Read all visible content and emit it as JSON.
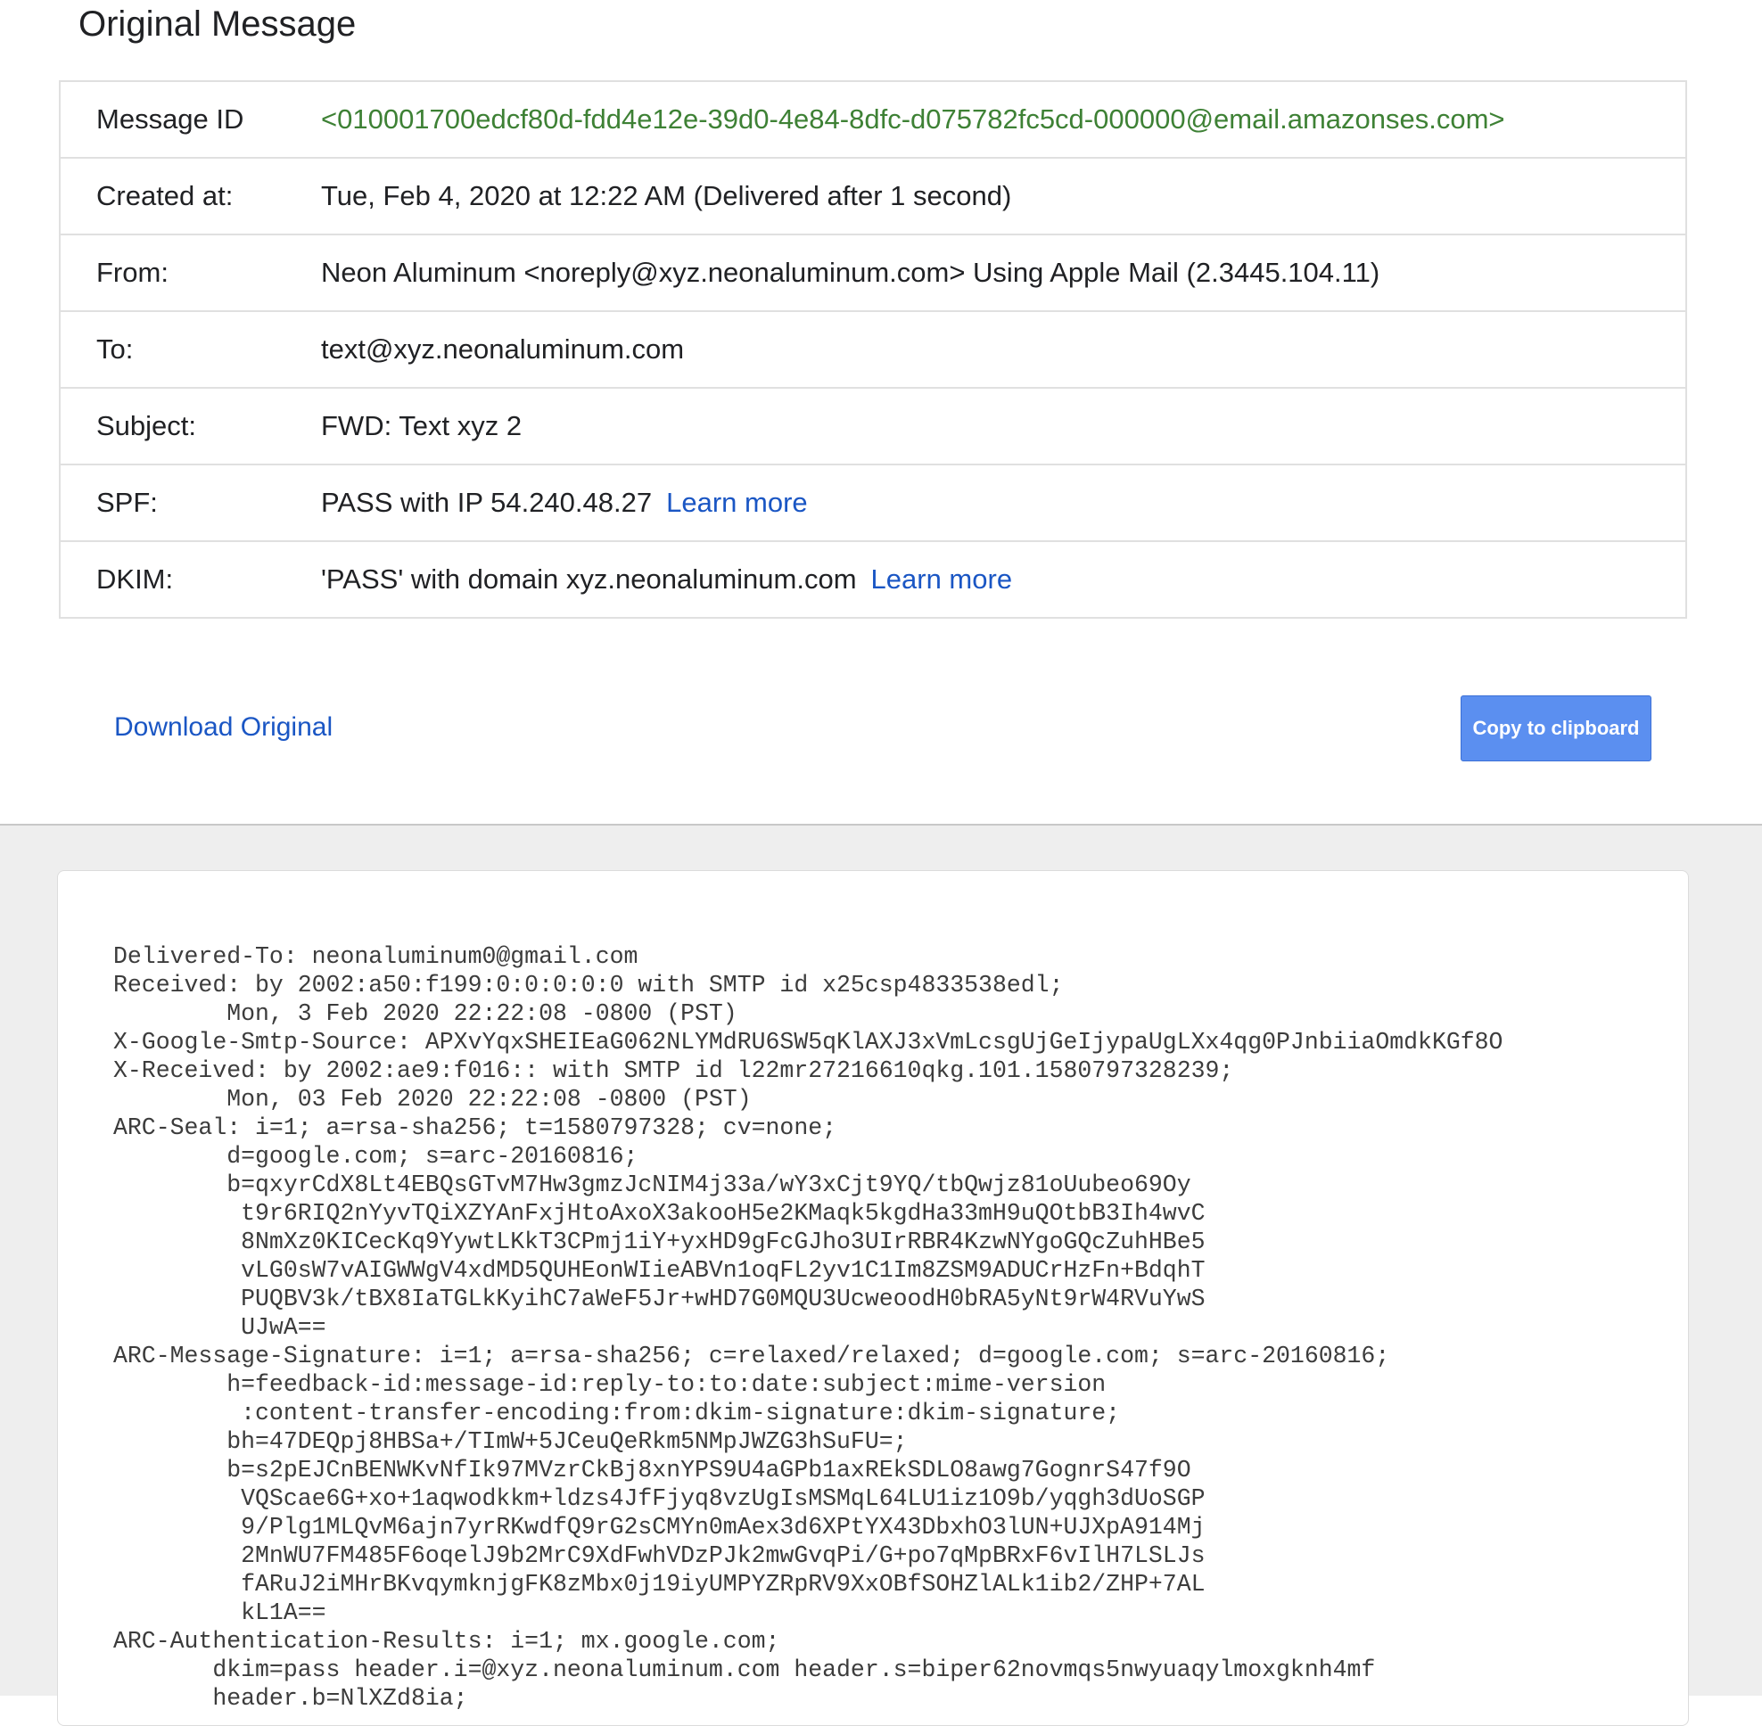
{
  "page": {
    "title": "Original Message"
  },
  "details": {
    "message_id": {
      "label": "Message ID",
      "value": "<010001700edcf80d-fdd4e12e-39d0-4e84-8dfc-d075782fc5cd-000000@email.amazonses.com>"
    },
    "created_at": {
      "label": "Created at:",
      "value": "Tue, Feb 4, 2020 at 12:22 AM (Delivered after 1 second)"
    },
    "from": {
      "label": "From:",
      "value": "Neon Aluminum <noreply@xyz.neonaluminum.com> Using Apple Mail (2.3445.104.11)"
    },
    "to": {
      "label": "To:",
      "value": "text@xyz.neonaluminum.com"
    },
    "subject": {
      "label": "Subject:",
      "value": "FWD: Text xyz 2"
    },
    "spf": {
      "label": "SPF:",
      "value": "PASS with IP 54.240.48.27",
      "link": "Learn more"
    },
    "dkim": {
      "label": "DKIM:",
      "value": "'PASS' with domain xyz.neonaluminum.com",
      "link": "Learn more"
    }
  },
  "actions": {
    "download_label": "Download Original",
    "copy_label": "Copy to clipboard"
  },
  "raw_source": "Delivered-To: neonaluminum0@gmail.com\nReceived: by 2002:a50:f199:0:0:0:0:0 with SMTP id x25csp4833538edl;\n        Mon, 3 Feb 2020 22:22:08 -0800 (PST)\nX-Google-Smtp-Source: APXvYqxSHEIEaG062NLYMdRU6SW5qKlAXJ3xVmLcsgUjGeIjypaUgLXx4qg0PJnbiiaOmdkKGf8O\nX-Received: by 2002:ae9:f016:: with SMTP id l22mr27216610qkg.101.1580797328239;\n        Mon, 03 Feb 2020 22:22:08 -0800 (PST)\nARC-Seal: i=1; a=rsa-sha256; t=1580797328; cv=none;\n        d=google.com; s=arc-20160816;\n        b=qxyrCdX8Lt4EBQsGTvM7Hw3gmzJcNIM4j33a/wY3xCjt9YQ/tbQwjz81oUubeo69Oy\n         t9r6RIQ2nYyvTQiXZYAnFxjHtoAxoX3akooH5e2KMaqk5kgdHa33mH9uQOtbB3Ih4wvC\n         8NmXz0KICecKq9YywtLKkT3CPmj1iY+yxHD9gFcGJho3UIrRBR4KzwNYgoGQcZuhHBe5\n         vLG0sW7vAIGWWgV4xdMD5QUHEonWIieABVn1oqFL2yv1C1Im8ZSM9ADUCrHzFn+BdqhT\n         PUQBV3k/tBX8IaTGLkKyihC7aWeF5Jr+wHD7G0MQU3UcweoodH0bRA5yNt9rW4RVuYwS\n         UJwA==\nARC-Message-Signature: i=1; a=rsa-sha256; c=relaxed/relaxed; d=google.com; s=arc-20160816;\n        h=feedback-id:message-id:reply-to:to:date:subject:mime-version\n         :content-transfer-encoding:from:dkim-signature:dkim-signature;\n        bh=47DEQpj8HBSa+/TImW+5JCeuQeRkm5NMpJWZG3hSuFU=;\n        b=s2pEJCnBENWKvNfIk97MVzrCkBj8xnYPS9U4aGPb1axREkSDLO8awg7GognrS47f9O\n         VQScae6G+xo+1aqwodkkm+ldzs4JfFjyq8vzUgIsMSMqL64LU1iz1O9b/yqgh3dUoSGP\n         9/Plg1MLQvM6ajn7yrRKwdfQ9rG2sCMYn0mAex3d6XPtYX43DbxhO3lUN+UJXpA914Mj\n         2MnWU7FM485F6oqelJ9b2MrC9XdFwhVDzPJk2mwGvqPi/G+po7qMpBRxF6vIlH7LSLJs\n         fARuJ2iMHrBKvqymknjgFK8zMbx0j19iyUMPYZRpRV9XxOBfSOHZlALk1ib2/ZHP+7AL\n         kL1A==\nARC-Authentication-Results: i=1; mx.google.com;\n       dkim=pass header.i=@xyz.neonaluminum.com header.s=biper62novmqs5nwyuaqylmoxgknh4mf\n       header.b=NlXZd8ia;"
}
